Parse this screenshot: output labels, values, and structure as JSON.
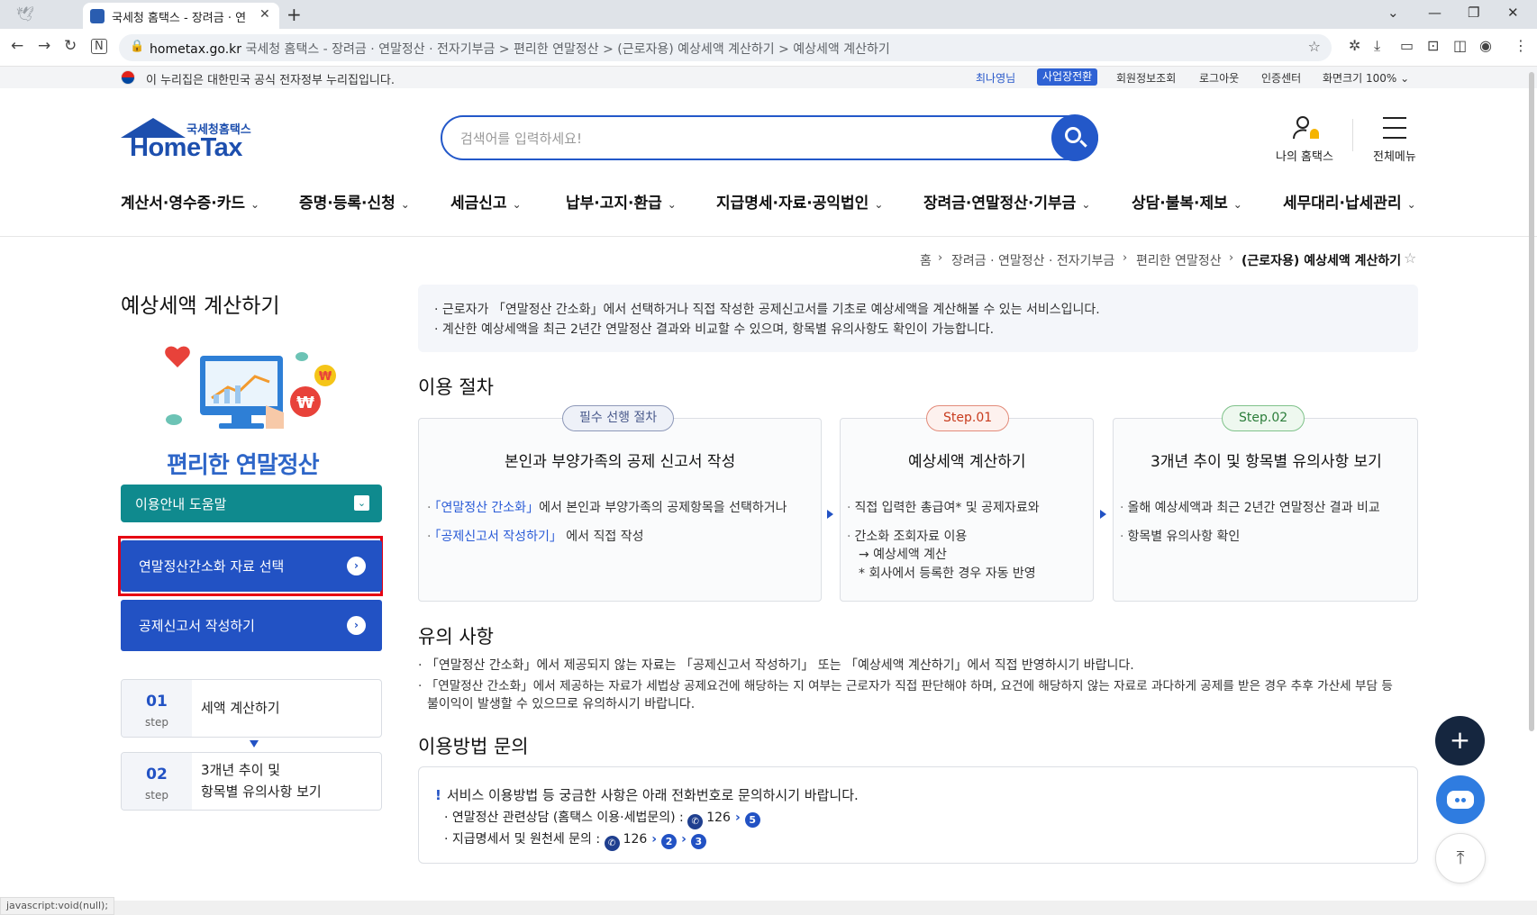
{
  "browser": {
    "tab_title": "국세청 홈택스 - 장려금 · 연말",
    "url_domain": "hometax.go.kr",
    "url_title": "국세청 홈택스 - 장려금 · 연말정산 · 전자기부금 > 편리한 연말정산 > (근로자용) 예상세액 계산하기 > 예상세액 계산하기",
    "status_text": "javascript:void(null);"
  },
  "govbar": {
    "notice": "이 누리집은 대한민국 공식 전자정부 누리집입니다.",
    "user": "최나영님",
    "business_switch": "사업장전환",
    "member_info": "회원정보조회",
    "logout": "로그아웃",
    "cert_center": "인증센터",
    "zoom": "화면크기 100% ⌄"
  },
  "header": {
    "logo_small": "국세청홈택스",
    "logo_main": "HomeTax",
    "search_placeholder": "검색어를 입력하세요!",
    "my_hometax": "나의 홈택스",
    "all_menu": "전체메뉴"
  },
  "gnb": [
    "계산서·영수증·카드",
    "증명·등록·신청",
    "세금신고",
    "납부·고지·환급",
    "지급명세·자료·공익법인",
    "장려금·연말정산·기부금",
    "상담·불복·제보",
    "세무대리·납세관리"
  ],
  "breadcrumb": {
    "home": "홈",
    "level1": "장려금 · 연말정산 · 전자기부금",
    "level2": "편리한 연말정산",
    "current": "(근로자용) 예상세액 계산하기"
  },
  "sidebar": {
    "page_title": "예상세액 계산하기",
    "illus_title": "편리한 연말정산",
    "help_button": "이용안내 도움말",
    "btn_simplified": "연말정산간소화 자료 선택",
    "btn_deduction": "공제신고서 작성하기",
    "steps": [
      {
        "num": "01",
        "step": "step",
        "line1": "세액 계산하기",
        "line2": ""
      },
      {
        "num": "02",
        "step": "step",
        "line1": "3개년 추이 및",
        "line2": "항목별 유의사항 보기"
      }
    ]
  },
  "intro": {
    "line1": "· 근로자가 「연말정산 간소화」에서 선택하거나 직접 작성한 공제신고서를 기초로 예상세액을 계산해볼 수 있는 서비스입니다.",
    "line2": "· 계산한 예상세액을 최근 2년간 연말정산 결과와 비교할 수 있으며, 항목별 유의사항도 확인이 가능합니다."
  },
  "procedure": {
    "title": "이용 절차",
    "cards": [
      {
        "pill": "필수 선행 절차",
        "title": "본인과 부양가족의 공제 신고서 작성",
        "l1_link": "「연말정산 간소화」",
        "l1_rest": "에서 본인과 부양가족의 공제항목을 선택하거나",
        "l2_link": "「공제신고서 작성하기」",
        "l2_rest": " 에서 직접 작성"
      },
      {
        "pill": "Step.01",
        "title": "예상세액 계산하기",
        "l1": "직접 입력한 총급여* 및 공제자료와",
        "l2": "간소화 조회자료 이용",
        "l3": "→ 예상세액 계산",
        "l4": "* 회사에서 등록한 경우 자동 반영"
      },
      {
        "pill": "Step.02",
        "title": "3개년 추이 및 항목별 유의사항 보기",
        "l1": "올해 예상세액과 최근 2년간 연말정산 결과 비교",
        "l2": "항목별 유의사항 확인"
      }
    ]
  },
  "notes": {
    "title": "유의 사항",
    "line1": "· 「연말정산 간소화」에서 제공되지 않는 자료는 「공제신고서 작성하기」 또는 「예상세액 계산하기」에서 직접 반영하시기 바랍니다.",
    "line2": "· 「연말정산 간소화」에서 제공하는 자료가 세법상 공제요건에 해당하는 지 여부는 근로자가 직접 판단해야 하며, 요건에 해당하지 않는 자료로 과다하게 공제를 받은 경우 추후 가산세 부담 등",
    "line3": "불이익이 발생할 수 있으므로 유의하시기 바랍니다."
  },
  "inquiry": {
    "title": "이용방법 문의",
    "head": "서비스 이용방법 등 궁금한 사항은 아래 전화번호로 문의하시기 바랍니다.",
    "row1_label": "연말정산 관련상담 (홈택스 이용·세법문의) :",
    "row1_num": "126",
    "row1_a": "5",
    "row2_label": "지급명세서 및 원천세 문의 :",
    "row2_num": "126",
    "row2_a": "2",
    "row2_b": "3"
  }
}
